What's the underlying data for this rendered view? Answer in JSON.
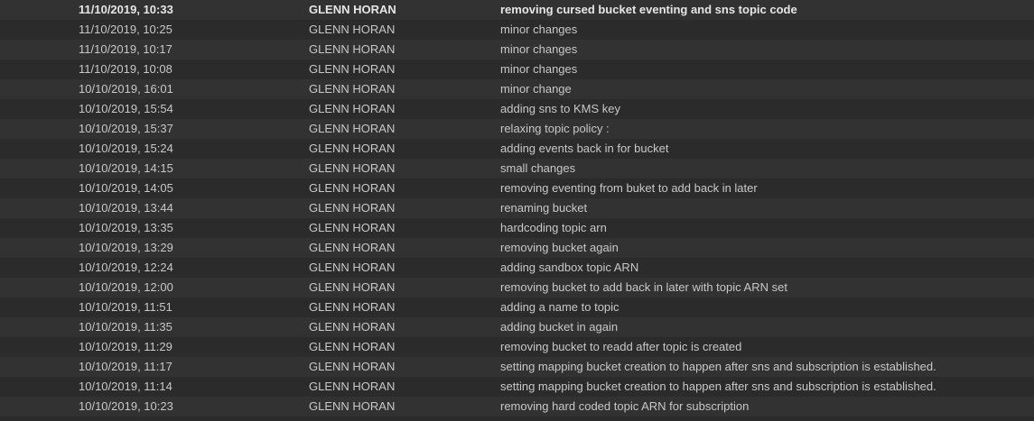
{
  "commits": [
    {
      "date": "11/10/2019, 10:33",
      "author": "GLENN HORAN",
      "message": "removing cursed bucket eventing and sns topic code"
    },
    {
      "date": "11/10/2019, 10:25",
      "author": "GLENN HORAN",
      "message": "minor changes"
    },
    {
      "date": "11/10/2019, 10:17",
      "author": "GLENN HORAN",
      "message": "minor changes"
    },
    {
      "date": "11/10/2019, 10:08",
      "author": "GLENN HORAN",
      "message": "minor changes"
    },
    {
      "date": "10/10/2019, 16:01",
      "author": "GLENN HORAN",
      "message": "minor change"
    },
    {
      "date": "10/10/2019, 15:54",
      "author": "GLENN HORAN",
      "message": "adding sns to KMS key"
    },
    {
      "date": "10/10/2019, 15:37",
      "author": "GLENN HORAN",
      "message": "relaxing topic policy :"
    },
    {
      "date": "10/10/2019, 15:24",
      "author": "GLENN HORAN",
      "message": "adding events back in for bucket"
    },
    {
      "date": "10/10/2019, 14:15",
      "author": "GLENN HORAN",
      "message": "small changes"
    },
    {
      "date": "10/10/2019, 14:05",
      "author": "GLENN HORAN",
      "message": "removing eventing from buket to add back in later"
    },
    {
      "date": "10/10/2019, 13:44",
      "author": "GLENN HORAN",
      "message": "renaming bucket"
    },
    {
      "date": "10/10/2019, 13:35",
      "author": "GLENN HORAN",
      "message": "hardcoding topic arn"
    },
    {
      "date": "10/10/2019, 13:29",
      "author": "GLENN HORAN",
      "message": "removing bucket again"
    },
    {
      "date": "10/10/2019, 12:24",
      "author": "GLENN HORAN",
      "message": "adding sandbox topic ARN"
    },
    {
      "date": "10/10/2019, 12:00",
      "author": "GLENN HORAN",
      "message": "removing bucket to add back in later with topic ARN set"
    },
    {
      "date": "10/10/2019, 11:51",
      "author": "GLENN HORAN",
      "message": "adding a name to topic"
    },
    {
      "date": "10/10/2019, 11:35",
      "author": "GLENN HORAN",
      "message": "adding bucket in again"
    },
    {
      "date": "10/10/2019, 11:29",
      "author": "GLENN HORAN",
      "message": "removing bucket to readd after topic is created"
    },
    {
      "date": "10/10/2019, 11:17",
      "author": "GLENN HORAN",
      "message": "setting mapping bucket creation to happen after sns and subscription is established."
    },
    {
      "date": "10/10/2019, 11:14",
      "author": "GLENN HORAN",
      "message": "setting mapping bucket creation to happen after sns and subscription is established."
    },
    {
      "date": "10/10/2019, 10:23",
      "author": "GLENN HORAN",
      "message": "removing hard coded topic ARN for subscription"
    }
  ],
  "colors": {
    "background": "#2b2b2b",
    "row_alt": "#323232",
    "text": "#c8c8c8",
    "text_selected": "#e6e6e6"
  }
}
